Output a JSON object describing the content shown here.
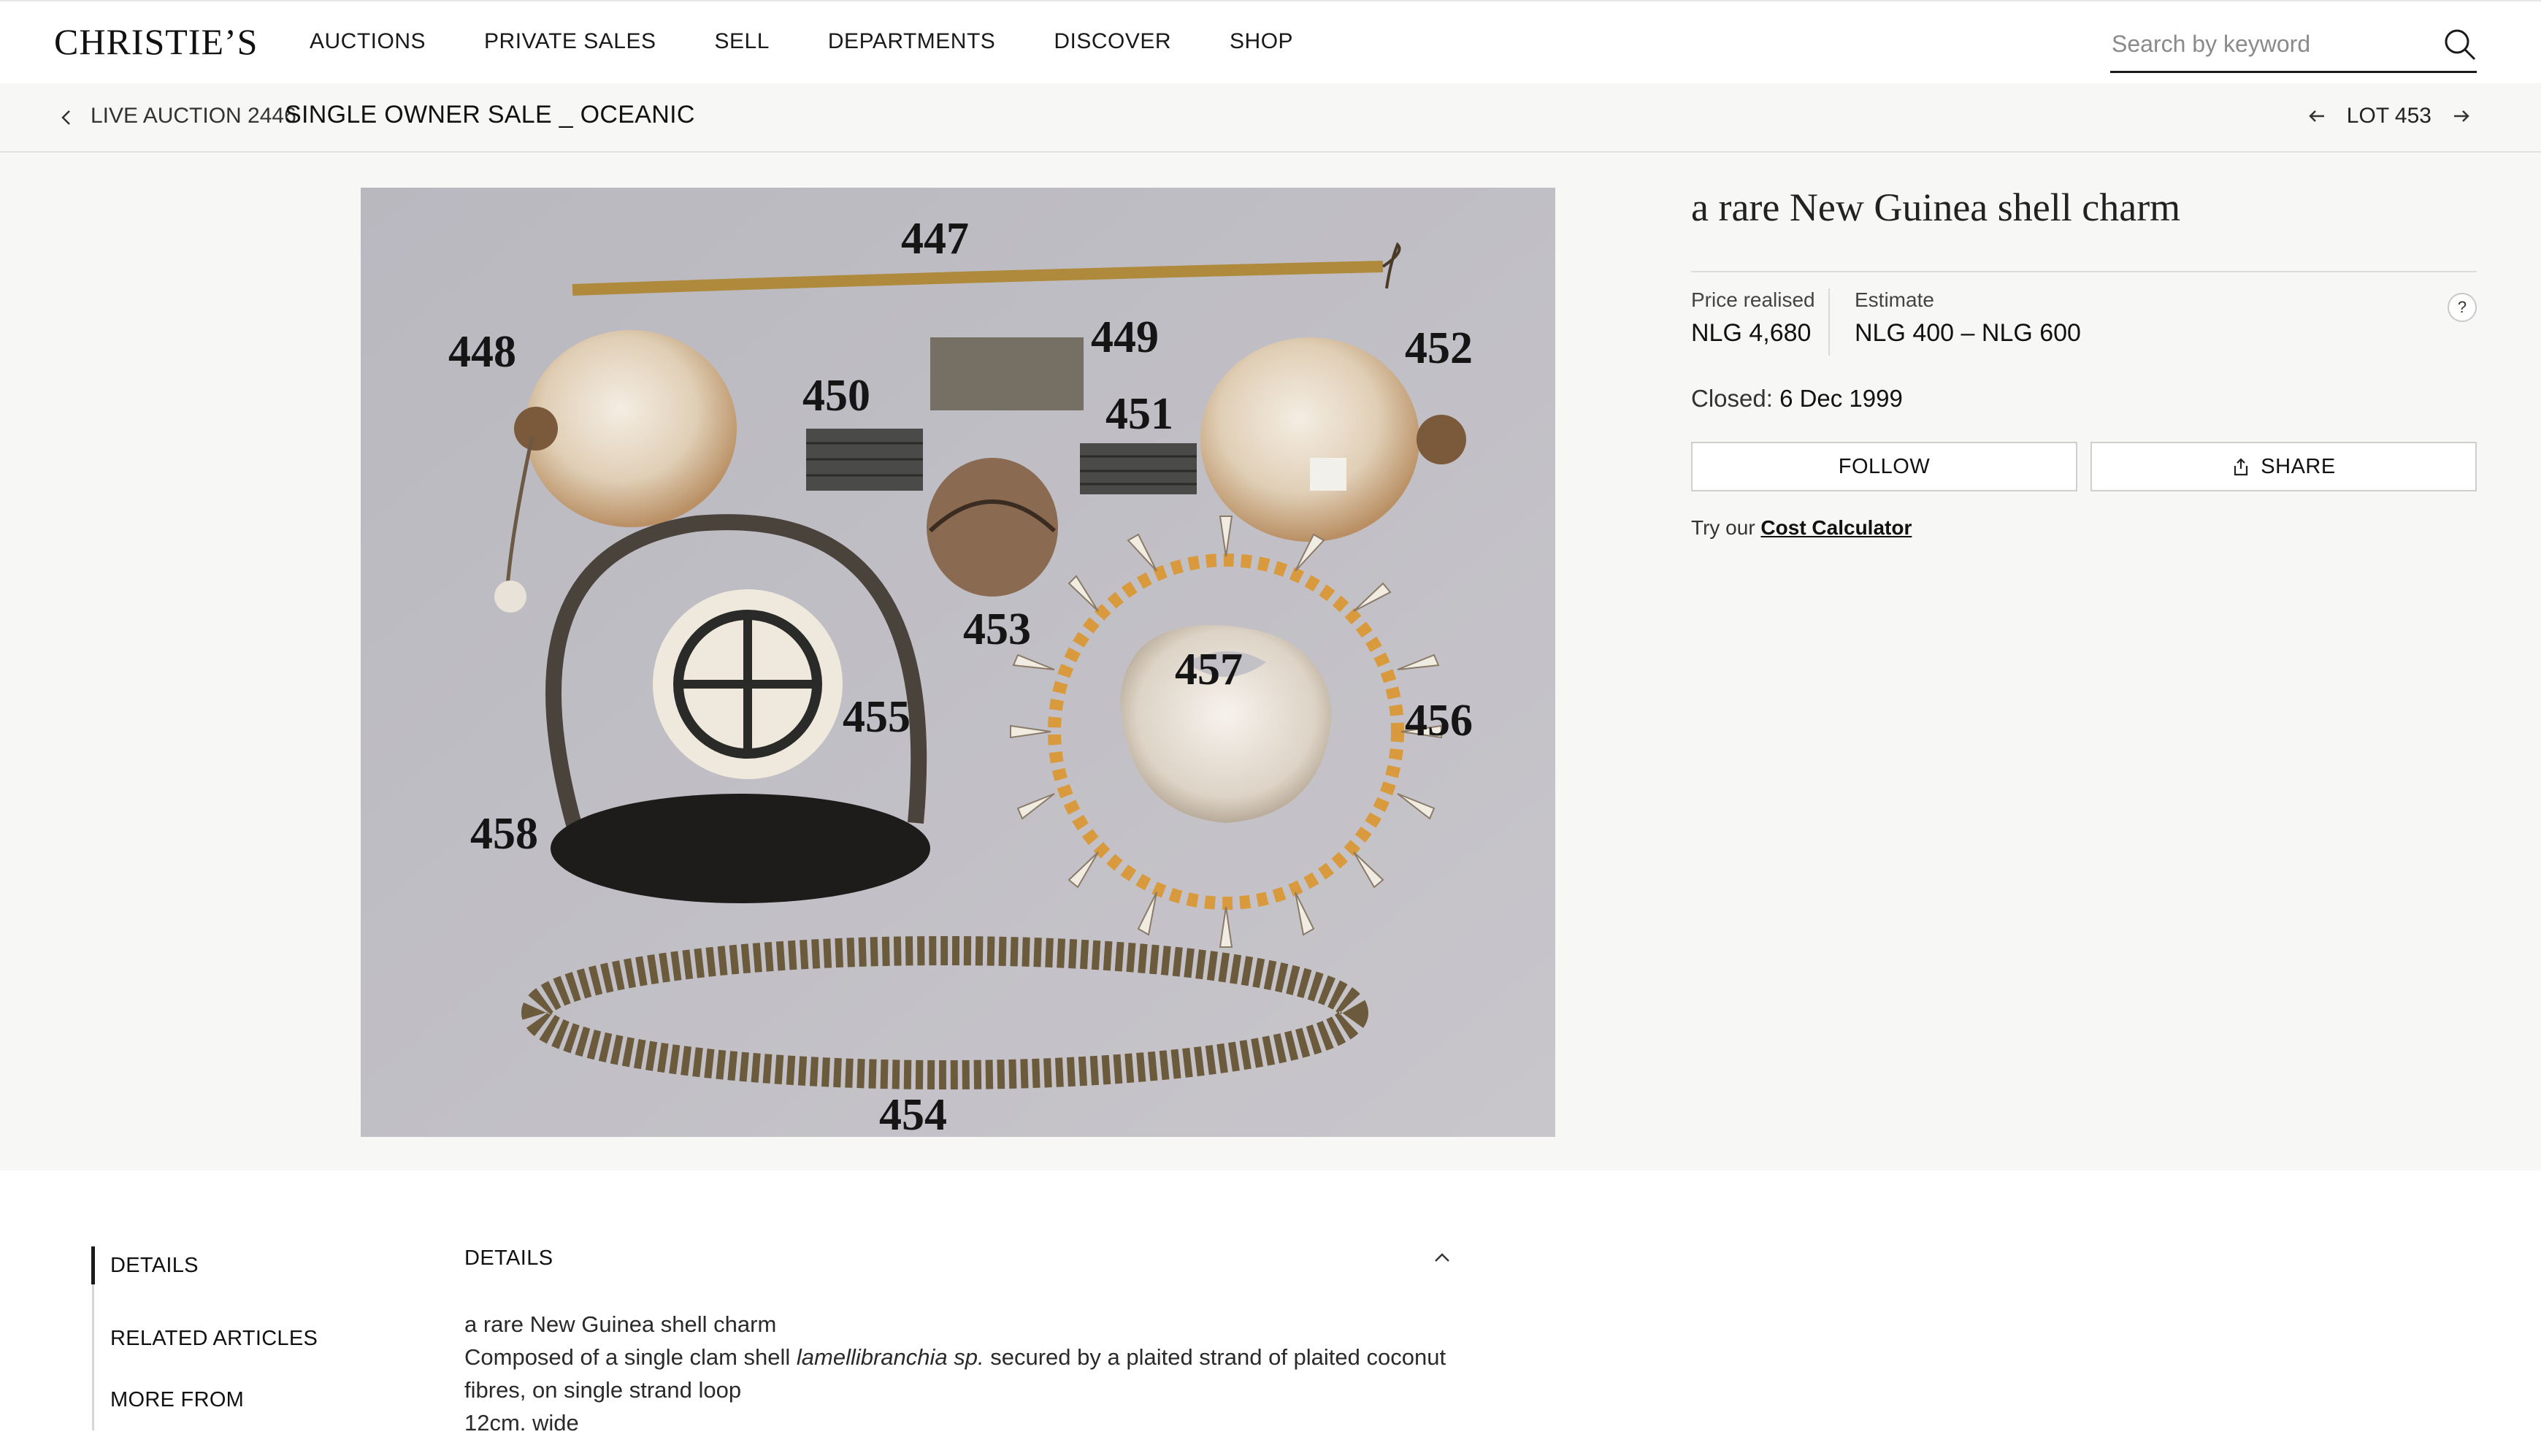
{
  "header": {
    "logo": "CHRISTIE’S",
    "nav": [
      "AUCTIONS",
      "PRIVATE SALES",
      "SELL",
      "DEPARTMENTS",
      "DISCOVER",
      "SHOP"
    ],
    "search_placeholder": "Search by keyword",
    "search_icon": "search-icon"
  },
  "breadcrumb": {
    "label": "LIVE AUCTION 2446",
    "title": "SINGLE OWNER SALE _ OCEANIC",
    "lot": "LOT 453"
  },
  "lot": {
    "title": "a rare New Guinea shell charm",
    "price_realised_label": "Price realised",
    "price_realised": "NLG 4,680",
    "estimate_label": "Estimate",
    "estimate": "NLG 400 – NLG 600",
    "help": "?",
    "closed_label": "Closed:",
    "closed_value": "6 Dec 1999",
    "follow": "FOLLOW",
    "share": "SHARE",
    "calc_prefix": "Try our",
    "calc_link": "Cost Calculator"
  },
  "image_labels": {
    "l447": "447",
    "l448": "448",
    "l449": "449",
    "l450": "450",
    "l451": "451",
    "l452": "452",
    "l453": "453",
    "l454": "454",
    "l455": "455",
    "l456": "456",
    "l457": "457",
    "l458": "458"
  },
  "lower": {
    "tabs": [
      "DETAILS",
      "RELATED ARTICLES",
      "MORE FROM"
    ],
    "details_heading": "DETAILS",
    "line1": "a rare New Guinea shell charm",
    "line2_a": "Composed of a single clam shell ",
    "line2_em": "lamellibranchia sp.",
    "line2_b": " secured by a plaited strand of plaited coconut",
    "line3": "fibres, on single strand loop",
    "line4": "12cm. wide"
  }
}
